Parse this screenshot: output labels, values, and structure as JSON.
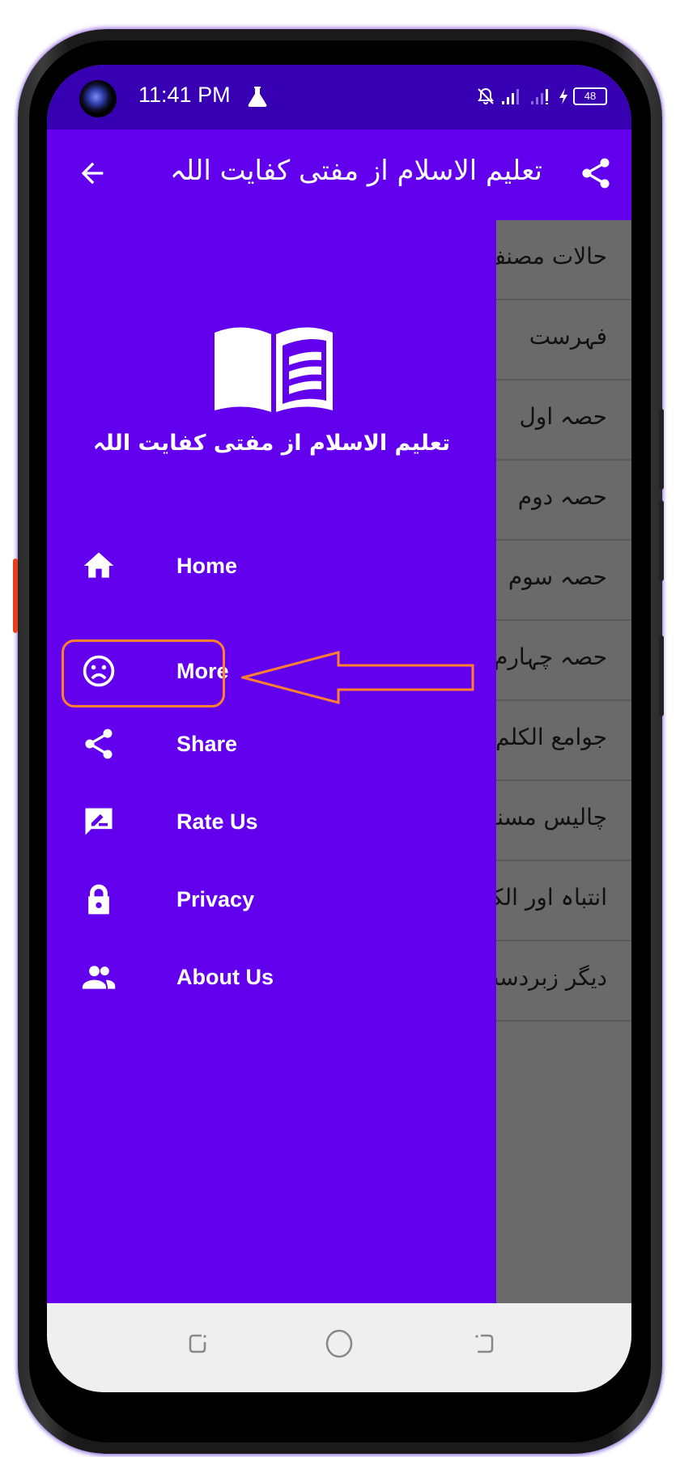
{
  "status_bar": {
    "time": "11:41 PM",
    "battery": "48",
    "icons": [
      "camera-cutout",
      "flask-icon",
      "bell-off-icon",
      "signal-icon",
      "signal-icon-2",
      "charging-icon",
      "battery-icon"
    ]
  },
  "app_bar": {
    "title": "تعلیم الاسلام از مفتی کفایت اللہ",
    "back_icon": "arrow-back-icon",
    "share_icon": "share-icon"
  },
  "drawer": {
    "header_title": "تعلیم الاسلام از مفتی کفایت اللہ",
    "logo_icon": "open-book-icon",
    "items": [
      {
        "label": "Home",
        "icon": "home-icon"
      },
      {
        "label": "More",
        "icon": "sad-face-icon",
        "highlighted": true
      },
      {
        "label": "Share",
        "icon": "share-icon"
      },
      {
        "label": "Rate Us",
        "icon": "rate-review-icon"
      },
      {
        "label": "Privacy",
        "icon": "lock-icon"
      },
      {
        "label": "About Us",
        "icon": "people-icon"
      }
    ]
  },
  "content_list": {
    "items": [
      "حالات مصنف",
      "فہرست",
      "حصہ اول",
      "حصہ دوم",
      "حصہ سوم",
      "حصہ چہارم",
      "جوامع الکلم",
      "چالیس مسنون",
      "انتباہ اور الکلام",
      "دیگر زبردست"
    ]
  },
  "annotation": {
    "highlight_color": "#ff7f30",
    "target": "More"
  },
  "colors": {
    "primary": "#6200ee",
    "primary_dark": "#3700b3",
    "scrim_gray": "#6a6a6a",
    "nav_bar": "#efefef"
  },
  "nav_bar": {
    "buttons": [
      "recents-icon",
      "home-circle-icon",
      "back-nav-icon"
    ]
  }
}
